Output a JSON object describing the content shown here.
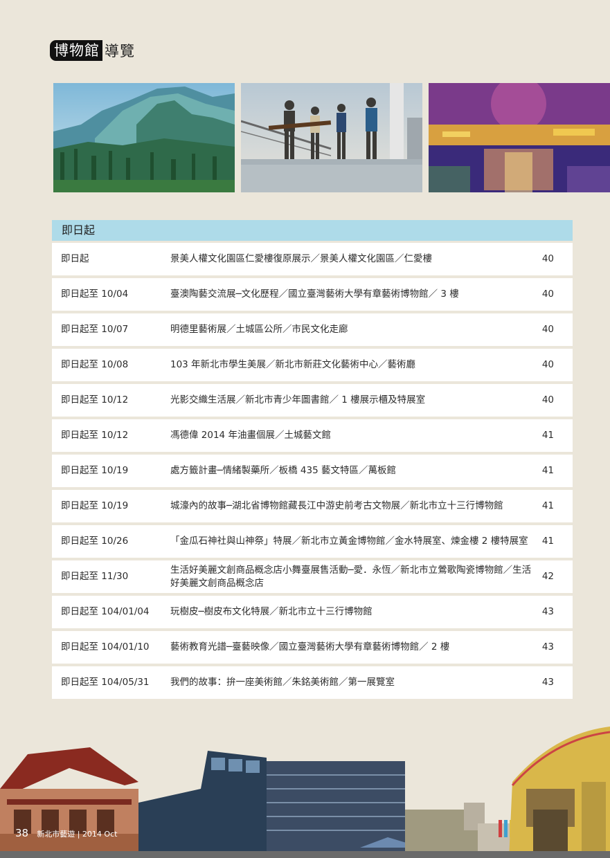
{
  "page_title": {
    "boxed": "博物館",
    "rest": "導覽"
  },
  "photos": [
    {
      "icon": "mountain-landscape-painting"
    },
    {
      "icon": "musicians-performance-photo"
    },
    {
      "icon": "impressionist-painting"
    }
  ],
  "section_header": "即日起",
  "listings": [
    {
      "date": "即日起",
      "title": "景美人權文化園區仁愛樓復原展示／景美人權文化園區／仁愛樓",
      "page": "40"
    },
    {
      "date": "即日起至 10/04",
      "title": "臺澳陶藝交流展─文化歷程／國立臺灣藝術大學有章藝術博物館／ 3 樓",
      "page": "40"
    },
    {
      "date": "即日起至 10/07",
      "title": "明德里藝術展／土城區公所／市民文化走廊",
      "page": "40"
    },
    {
      "date": "即日起至 10/08",
      "title": "103 年新北市學生美展／新北市新莊文化藝術中心／藝術廳",
      "page": "40"
    },
    {
      "date": "即日起至 10/12",
      "title": "光影交織生活展／新北市青少年圖書館／ 1 樓展示櫃及特展室",
      "page": "40"
    },
    {
      "date": "即日起至 10/12",
      "title": "馮德偉 2014 年油畫個展／土城藝文館",
      "page": "41"
    },
    {
      "date": "即日起至 10/19",
      "title": "處方籤計畫─情緒製藥所／板橋 435 藝文特區／萬板館",
      "page": "41"
    },
    {
      "date": "即日起至 10/19",
      "title": "城濠內的故事─湖北省博物館藏長江中游史前考古文物展／新北市立十三行博物館",
      "page": "41"
    },
    {
      "date": "即日起至 10/26",
      "title": "「金瓜石神社與山神祭」特展／新北市立黃金博物館／金水特展室、煉金樓 2 樓特展室",
      "page": "41"
    },
    {
      "date": "即日起至 11/30",
      "title": "生活好美麗文創商品概念店小舞臺展售活動─愛．永恆／新北市立鶯歌陶瓷博物館／生活好美麗文創商品概念店",
      "page": "42"
    },
    {
      "date": "即日起至 104/01/04",
      "title": "玩樹皮─樹皮布文化特展／新北市立十三行博物館",
      "page": "43"
    },
    {
      "date": "即日起至 104/01/10",
      "title": "藝術教育光譜─臺藝映像／國立臺灣藝術大學有章藝術博物館／ 2 樓",
      "page": "43"
    },
    {
      "date": "即日起至 104/05/31",
      "title": "我們的故事：拚一座美術館／朱銘美術館／第一展覽室",
      "page": "43"
    }
  ],
  "footer": {
    "page_number": "38",
    "magazine": "新北市藝遊 | 2014 Oct"
  },
  "colors": {
    "header_bg": "#aedbe9",
    "page_bg": "#ebe6da",
    "row_bg": "#ffffff"
  }
}
